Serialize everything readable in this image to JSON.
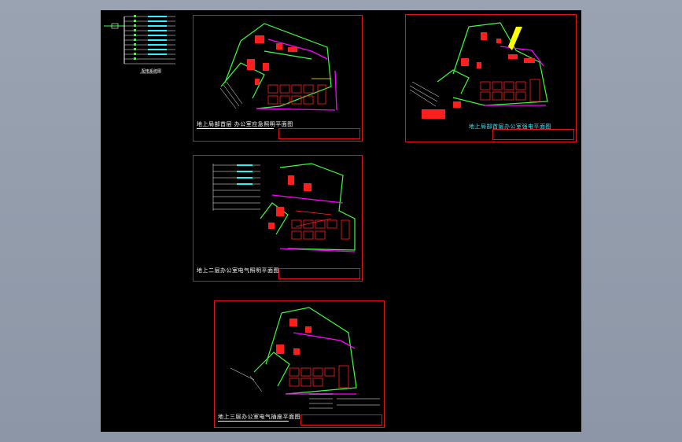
{
  "colors": {
    "background": "#8c96a6",
    "model_space": "#000000",
    "frame": "#e0141e",
    "wall_green": "#3cff3c",
    "hatch_red": "#ff1e1e",
    "wall_magenta": "#ff00ff",
    "text_white": "#ffffff",
    "text_cyan": "#2ff0ff",
    "yellow": "#ffff00"
  },
  "legend_top": {
    "label": "配电系统图"
  },
  "sheets": [
    {
      "id": "sheet-1",
      "title": "地上局部首层 办公室应急照明平面图",
      "cyan": false
    },
    {
      "id": "sheet-2",
      "title": "地上局部首层办公室强电平面图",
      "cyan": true
    },
    {
      "id": "sheet-3",
      "title": "地上二层办公室电气照明平面图",
      "cyan": false
    },
    {
      "id": "sheet-4",
      "title": "地上三层办公室电气插座平面图",
      "cyan": false
    }
  ]
}
